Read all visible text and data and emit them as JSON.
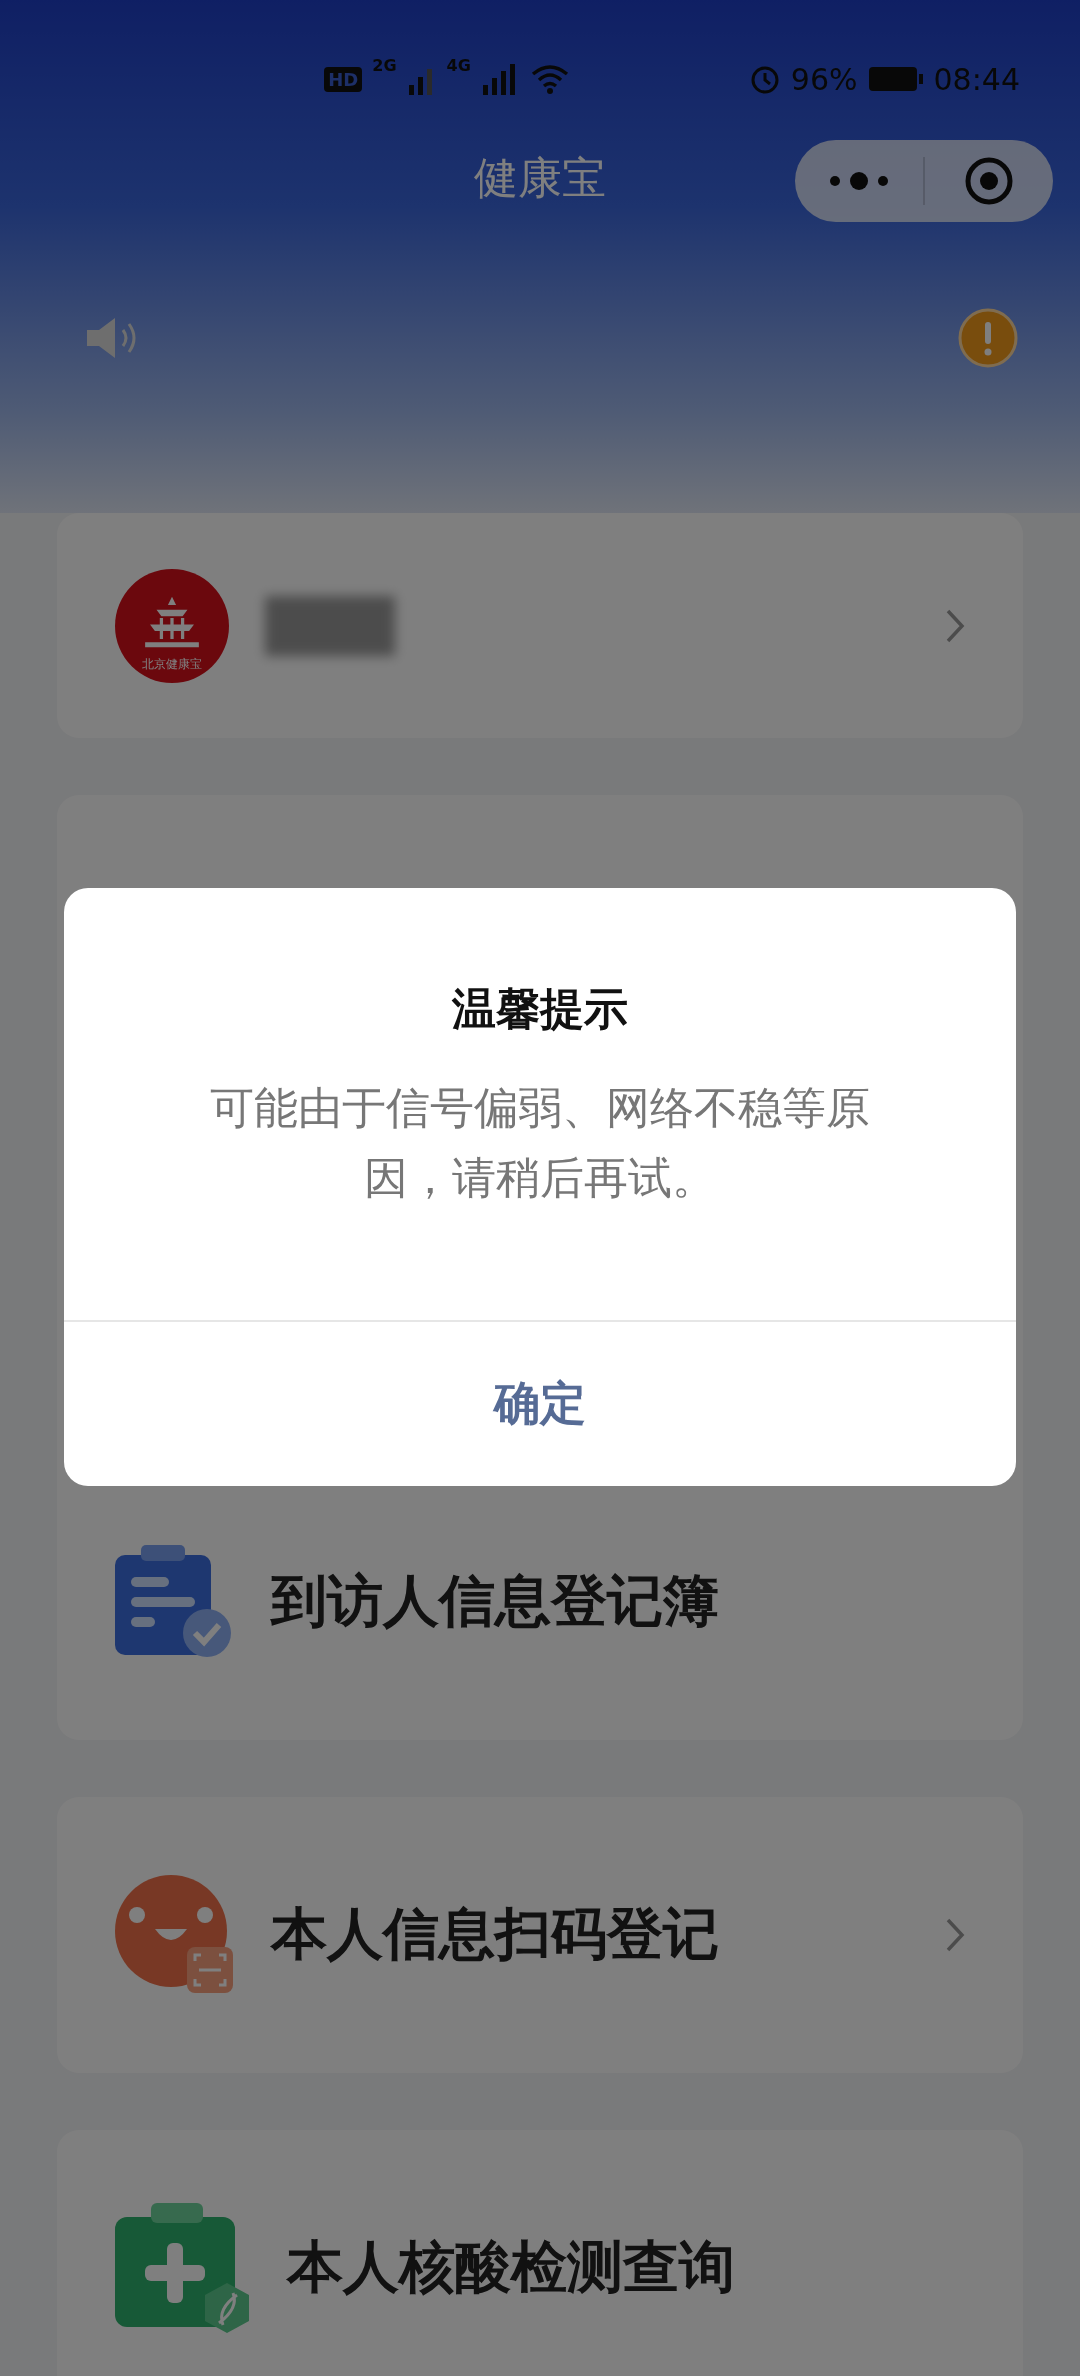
{
  "status_bar": {
    "hd": "HD",
    "sim_1": "2G",
    "sim_2": "4G",
    "battery": "96%",
    "time": "08:44"
  },
  "nav": {
    "title": "健康宝"
  },
  "profile": {
    "logo_caption": "北京健康宝",
    "chevron": true
  },
  "menu_cards": [
    {
      "label": "到访人信息登记簿",
      "kind": "clipboard",
      "chevron": false
    },
    {
      "label": "本人信息扫码登记",
      "kind": "scan-face",
      "chevron": true
    },
    {
      "label": "本人核酸检测查询",
      "kind": "medical-kit",
      "chevron": false
    }
  ],
  "dialog": {
    "title": "温馨提示",
    "message": "可能由于信号偏弱、网络不稳等原因，请稍后再试。",
    "button": "确定"
  }
}
